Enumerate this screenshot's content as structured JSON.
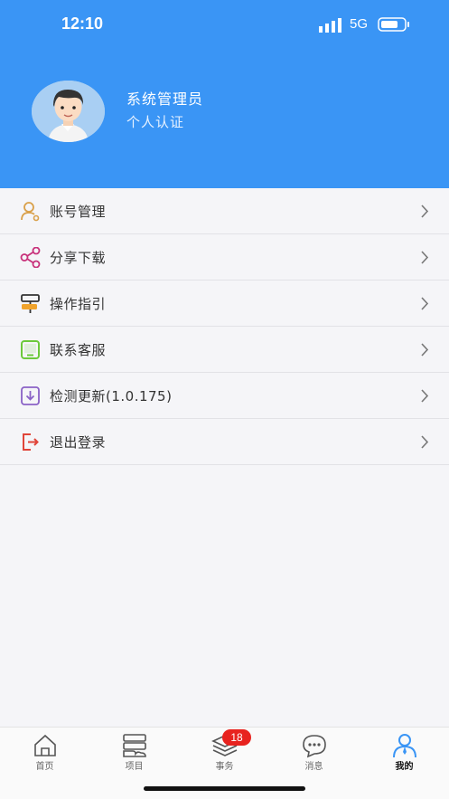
{
  "status_bar": {
    "time": "12:10",
    "network": "5G"
  },
  "profile": {
    "name": "系统管理员",
    "subtitle": "个人认证"
  },
  "menu": {
    "items": [
      {
        "label": "账号管理",
        "icon": "user-gear-icon",
        "color": "#d9a04a"
      },
      {
        "label": "分享下载",
        "icon": "share-icon",
        "color": "#c8327b"
      },
      {
        "label": "操作指引",
        "icon": "signpost-icon",
        "color": "#f0a32c"
      },
      {
        "label": "联系客服",
        "icon": "tablet-icon",
        "color": "#6cc93b"
      },
      {
        "label": "检测更新(1.0.175)",
        "icon": "download-icon",
        "color": "#8a62c6"
      },
      {
        "label": "退出登录",
        "icon": "logout-icon",
        "color": "#e0453a"
      }
    ]
  },
  "tabbar": {
    "tabs": [
      {
        "label": "首页",
        "icon": "home-icon"
      },
      {
        "label": "项目",
        "icon": "project-icon"
      },
      {
        "label": "事务",
        "icon": "layers-icon"
      },
      {
        "label": "消息",
        "icon": "message-icon"
      },
      {
        "label": "我的",
        "icon": "profile-icon",
        "active": true
      }
    ],
    "badge": "18"
  },
  "colors": {
    "header": "#3a95f5",
    "accent": "#3a95f5",
    "badge": "#e8231f"
  }
}
